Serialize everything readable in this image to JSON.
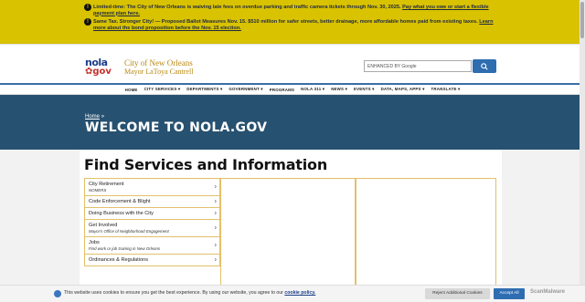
{
  "alerts": [
    {
      "text": "Limited-time: The City of New Orleans is waiving late fees on overdue parking and traffic camera tickets through Nov. 30, 2025.",
      "link": "Pay what you owe or start a flexible payment plan here."
    },
    {
      "text": "Same Tax. Stronger City! — Proposed Ballot Measures Nov. 15. $510 million for safer streets, better drainage, more affordable homes paid from existing taxes.",
      "link": "Learn more about the bond proposition before the Nov. 15 election."
    }
  ],
  "header": {
    "logo_top": "nola",
    "logo_bottom": "gov",
    "title": "City of New Orleans",
    "subtitle": "Mayor LaToya Cantrell",
    "search_placeholder": "ENHANCED BY Google"
  },
  "nav": [
    "HOME",
    "CITY SERVICES ▾",
    "DEPARTMENTS ▾",
    "GOVERNMENT ▾",
    "PROGRAMS",
    "NOLA 311 ▾",
    "NEWS ▾",
    "EVENTS ▾",
    "DATA, MAPS, APPS ▾",
    "TRANSLATE ▾"
  ],
  "hero": {
    "breadcrumb": "Home",
    "breadcrumb_sep": "»",
    "title": "WELCOME TO NOLA.GOV"
  },
  "main": {
    "heading": "Find Services and Information",
    "services": [
      {
        "label": "City Retirement",
        "sub": "NOMERS"
      },
      {
        "label": "Code Enforcement & Blight",
        "sub": ""
      },
      {
        "label": "Doing Business with the City",
        "sub": ""
      },
      {
        "label": "Get Involved",
        "sub": "Mayor's Office of Neighborhood Engagement"
      },
      {
        "label": "Jobs",
        "sub": "Find work or job training in New Orleans"
      },
      {
        "label": "Ordinances & Regulations",
        "sub": ""
      }
    ]
  },
  "cookie": {
    "text": "This website uses cookies to ensure you get the best experience. By using our website, you agree to our",
    "link": "cookie policy.",
    "reject": "Reject Additional Cookies",
    "accept": "Accept All",
    "watermark": "ScanMalware"
  },
  "colors": {
    "alert_bg": "#d9c200",
    "hero_bg": "#275170",
    "accent_gold": "#b98a14",
    "button_blue": "#2f6db3"
  }
}
